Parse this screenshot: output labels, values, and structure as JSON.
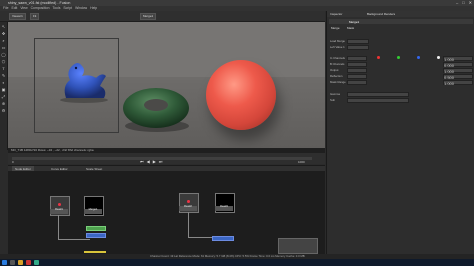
{
  "window": {
    "title": "shiny_sawn_v01.fst (modified) - Fusion",
    "controls": [
      "–",
      "□",
      "✕"
    ]
  },
  "menu": [
    "File",
    "Edit",
    "View",
    "Composition",
    "Tools",
    "Script",
    "Window",
    "Help"
  ],
  "toolbar": {
    "viewer_label": "Viewer1",
    "zoom": "Fit",
    "mode_label": "Merge1"
  },
  "viewer": {
    "status_text": "MO_T1B 1280x720  Rows: ~32 , ~22 , 2/2/ 8h2  channels: rgba",
    "right_status": "MO_T1B 1280x720"
  },
  "playback": {
    "frame": "0",
    "end_frame": "1000",
    "controls": [
      "⏮",
      "◀",
      "▶",
      "⏭"
    ]
  },
  "node_tabs": [
    "Node Editor",
    "Curve Editor",
    "Scale Sheet"
  ],
  "nodes": [
    {
      "label": "Read1",
      "sub": "shiny_saw"
    },
    {
      "label": "Merge1",
      "sub": "mask"
    },
    {
      "label": "Read2",
      "sub": "shiny_saw"
    },
    {
      "label": "Read3",
      "sub": "shiny_saw"
    }
  ],
  "inspector": {
    "tabs": [
      "Inspector",
      "Background Renders"
    ],
    "node_name": "Merge1",
    "sections": [
      "Merge",
      "Mask"
    ],
    "fields": [
      "Load Merge",
      "Left Value 1",
      "In Channels",
      "B Channels",
      "Output",
      "Reflection",
      "Mask Range",
      "Gamma",
      "Sub"
    ],
    "values": [
      "1.000",
      "0.000",
      "1.000",
      "0.500",
      "1.000"
    ]
  },
  "status_bar": "Channel Count: 19  Lat Reference Mode: 61  Memory: 5.7 GB (8.4%)  CPU: 5.5%  Frame Time: 0.0 ms  Memory Cache: 0.0 MB",
  "colors": {
    "accent_blue": "#3b66c4",
    "green": "#4ea14e",
    "sphere": "#e4503f",
    "donut": "#2f5a38",
    "dino": "#2f52b8"
  }
}
